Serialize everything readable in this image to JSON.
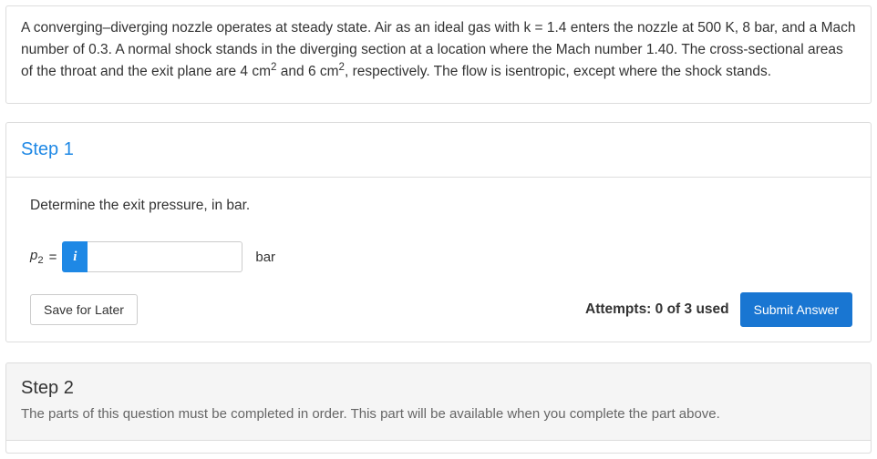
{
  "problem": "A converging–diverging nozzle operates at steady state. Air as an ideal gas with k = 1.4 enters the nozzle at 500 K, 8 bar, and a Mach number of 0.3. A normal shock stands in the diverging section at a location where the Mach number 1.40. The cross-sectional areas of the throat and the exit plane are 4 cm² and 6 cm², respectively. The flow is isentropic, except where the shock stands.",
  "step1": {
    "title": "Step 1",
    "instruction": "Determine the exit pressure, in bar.",
    "variable_html": "p<span class='sub'>2</span>",
    "equals": "=",
    "info_icon": "i",
    "input_value": "",
    "unit": "bar",
    "save_label": "Save for Later",
    "attempts": "Attempts: 0 of 3 used",
    "submit_label": "Submit Answer"
  },
  "step2": {
    "title": "Step 2",
    "message": "The parts of this question must be completed in order. This part will be available when you complete the part above."
  }
}
